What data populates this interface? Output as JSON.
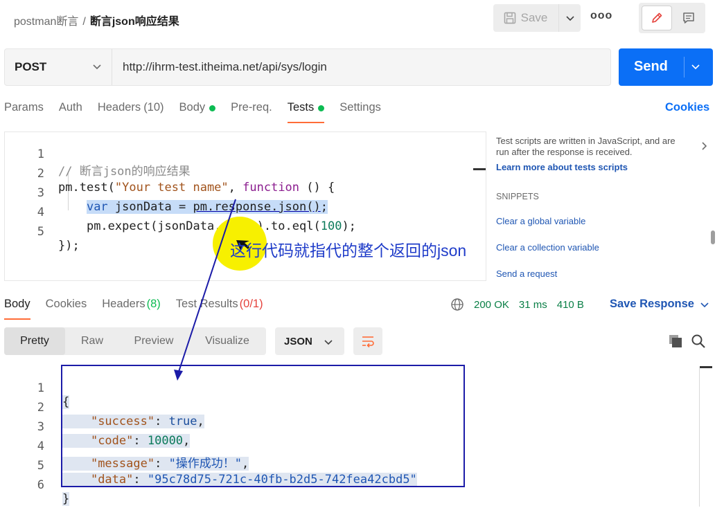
{
  "header": {
    "parent": "postman断言",
    "separator": "/",
    "current": "断言json响应结果",
    "save_label": "Save",
    "more_label": "ooo"
  },
  "request": {
    "method": "POST",
    "url": "http://ihrm-test.itheima.net/api/sys/login",
    "send_label": "Send"
  },
  "request_tabs": [
    {
      "label": "Params",
      "count": ""
    },
    {
      "label": "Auth",
      "count": ""
    },
    {
      "label": "Headers",
      "count": "(10)"
    },
    {
      "label": "Body",
      "count": ""
    },
    {
      "label": "Pre-req.",
      "count": ""
    },
    {
      "label": "Tests",
      "count": ""
    },
    {
      "label": "Settings",
      "count": ""
    }
  ],
  "cookies_label": "Cookies",
  "script": {
    "line_numbers": [
      "1",
      "2",
      "3",
      "4",
      "5"
    ],
    "l1_comment": "// 断言json的响应结果",
    "l2_a": "pm.test(",
    "l2_str": "\"Your test name\"",
    "l2_b": ", ",
    "l2_kw": "function",
    "l2_c": " () {",
    "l3_indent": "    ",
    "l3_kw": "var",
    "l3_a": " jsonData = ",
    "l3_b": "pm.response.json()",
    "l3_c": ";",
    "l4_indent": "    ",
    "l4_a": "pm.expect(jsonData.value).to.eql(",
    "l4_num": "100",
    "l4_b": ");",
    "l5": "});"
  },
  "side_panel": {
    "description": "Test scripts are written in JavaScript, and are run after the response is received.",
    "learn_link": "Learn more about tests scripts",
    "snippets_heading": "SNIPPETS",
    "snippets": [
      "Clear a global variable",
      "Clear a collection variable",
      "Send a request"
    ]
  },
  "annotation": "这行代码就指代的整个返回的json",
  "response_tabs": [
    {
      "label": "Body",
      "count": ""
    },
    {
      "label": "Cookies",
      "count": ""
    },
    {
      "label": "Headers",
      "count": "(8)"
    },
    {
      "label": "Test Results",
      "count": "(0/1)"
    }
  ],
  "response_meta": {
    "status": "200 OK",
    "time": "31 ms",
    "size": "410 B",
    "save_response": "Save Response"
  },
  "view_tabs": [
    "Pretty",
    "Raw",
    "Preview",
    "Visualize"
  ],
  "format": "JSON",
  "response_body": {
    "line_numbers": [
      "1",
      "2",
      "3",
      "4",
      "5",
      "6"
    ],
    "open": "{",
    "success_key": "\"success\"",
    "success_val": "true",
    "code_key": "\"code\"",
    "code_val": "10000",
    "message_key": "\"message\"",
    "message_val": "\"操作成功！\"",
    "data_key": "\"data\"",
    "data_val": "\"95c78d75-721c-40fb-b2d5-742fea42cbd5\"",
    "close": "}",
    "colon": ": ",
    "comma": ","
  },
  "colors": {
    "accent_orange": "#ff6c37",
    "send_blue": "#0b6ff6",
    "link_blue": "#1f56b3",
    "status_green": "#0cbb52",
    "annotation_blue": "#1f3cc9",
    "marker_yellow": "#f7f000"
  }
}
